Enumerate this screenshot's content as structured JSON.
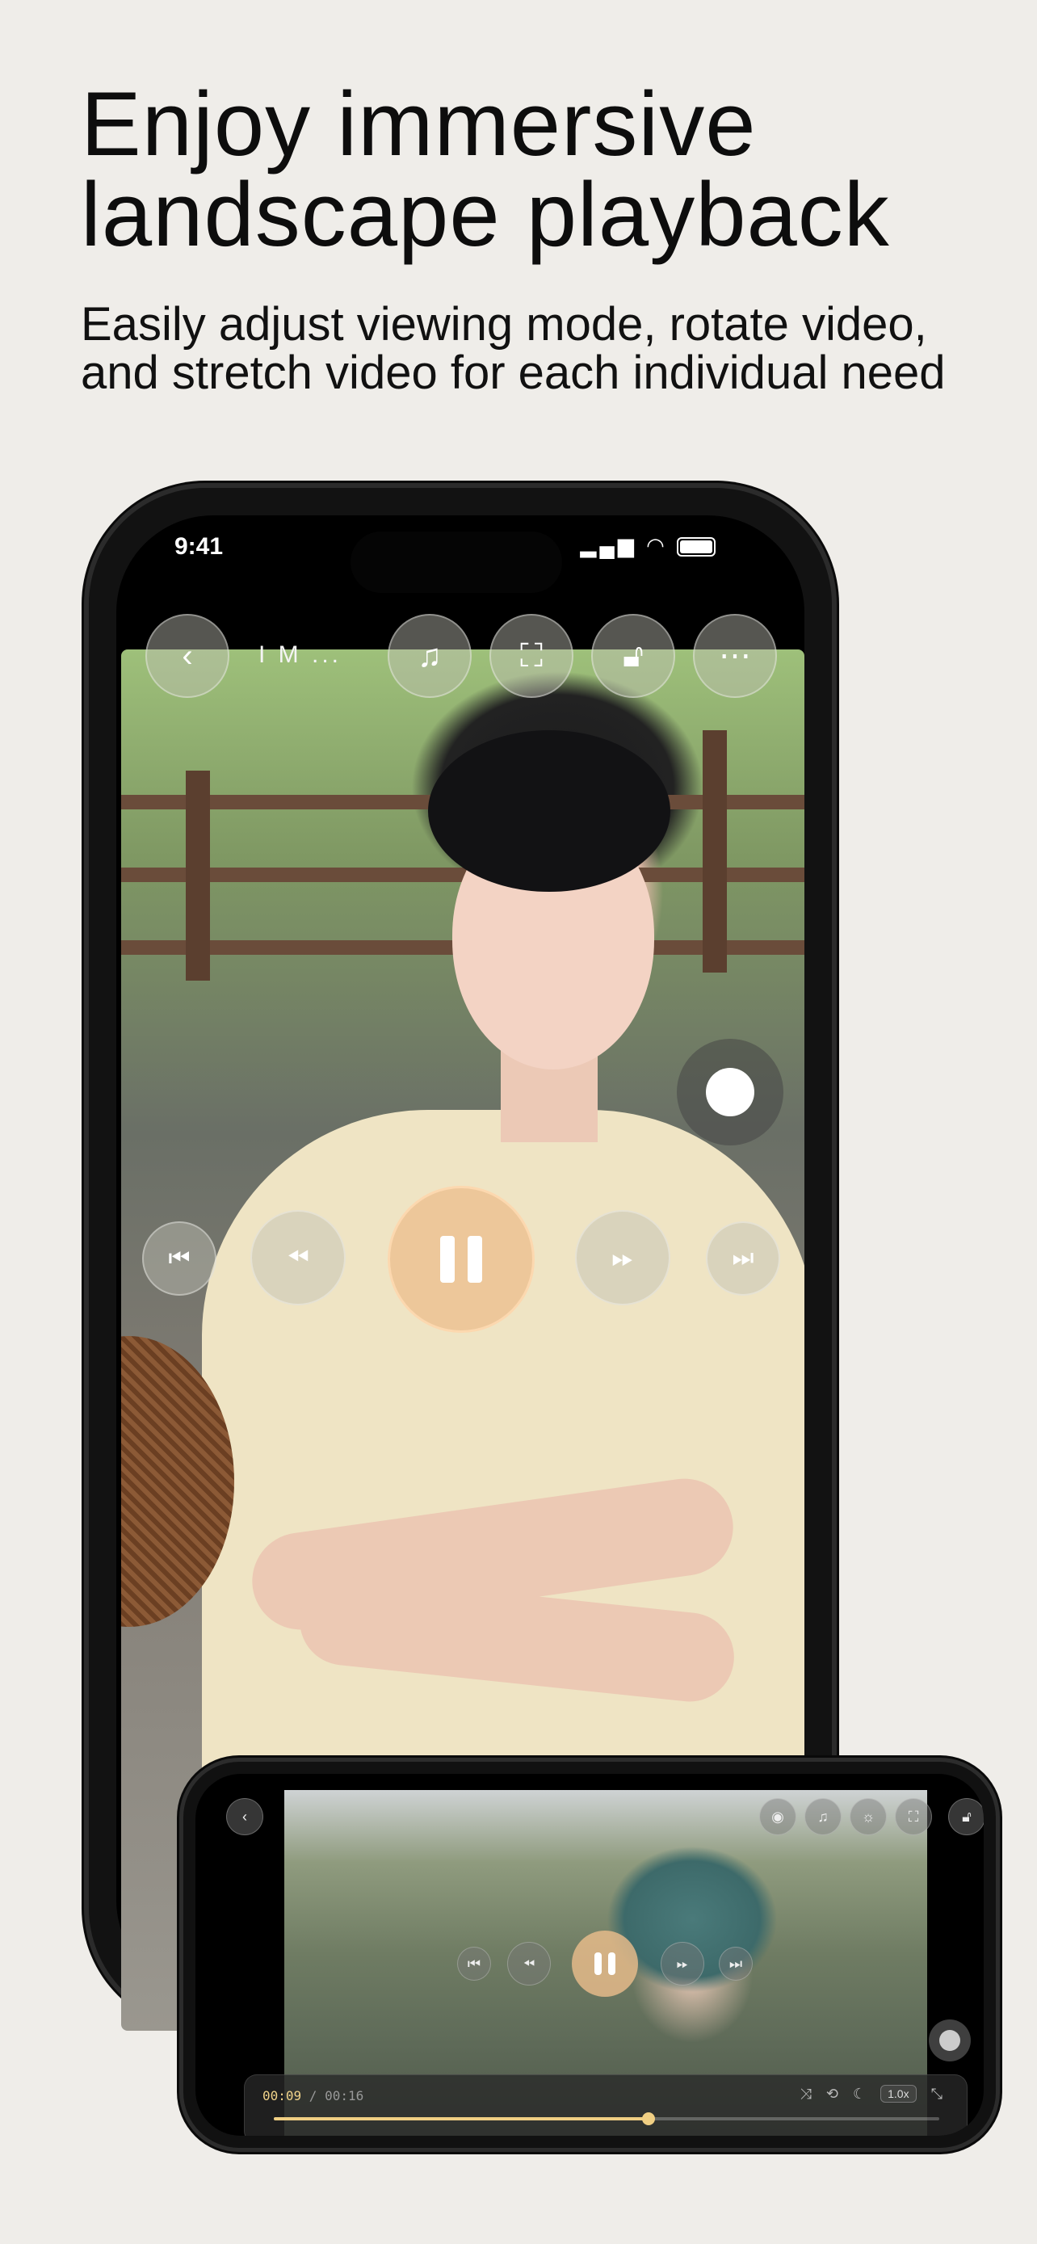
{
  "headline": "Enjoy immersive landscape playback",
  "subheadline": "Easily adjust viewing mode, rotate video, and stretch video for each individual need",
  "portrait": {
    "status_time": "9:41",
    "video_title": "I M ...",
    "icons": {
      "back": "chevron-left-icon",
      "music": "music-note-icon",
      "aspect": "aspect-ratio-icon",
      "lock": "unlock-icon",
      "more": "more-icon",
      "prev": "skip-previous-icon",
      "rewind": "rewind-icon",
      "pause": "pause-icon",
      "forward": "fast-forward-icon",
      "next": "skip-next-icon"
    }
  },
  "landscape": {
    "current_time": "00:09",
    "separator": " / ",
    "duration": "00:16",
    "speed": "1.0x",
    "progress": 0.5625
  },
  "colors": {
    "accent": "#f0cf83",
    "pause_button": "#ecbe8c",
    "background": "#efede9"
  }
}
